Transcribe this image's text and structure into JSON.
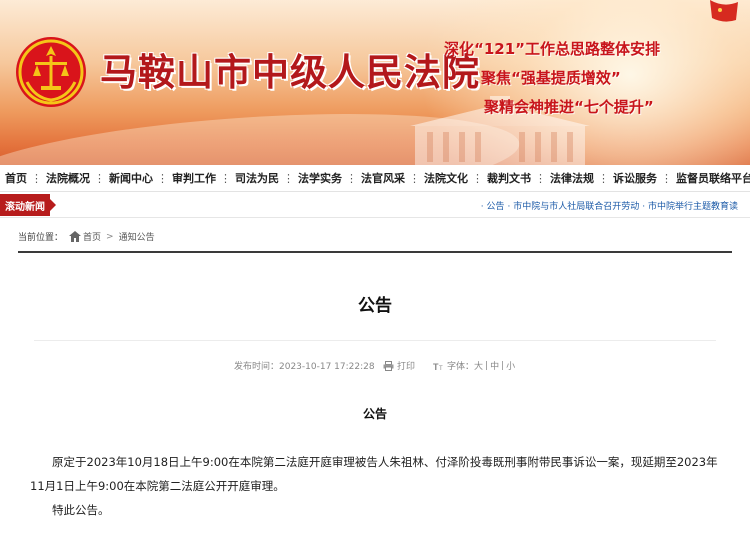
{
  "header": {
    "court_name": "马鞍山市中级人民法院",
    "slogans": [
      "深化“121”工作总思路整体安排",
      "聚焦“强基提质增效”",
      "聚精会神推进“七个提升”"
    ]
  },
  "nav": {
    "items": [
      "首页",
      "法院概况",
      "新闻中心",
      "审判工作",
      "司法为民",
      "法学实务",
      "法官风采",
      "法院文化",
      "裁判文书",
      "法律法规",
      "诉讼服务",
      "监督员联络平台"
    ]
  },
  "scroll_news": {
    "label": "滚动新闻",
    "items": [
      "· 公告",
      "· 市中院与市人社局联合召开劳动",
      "· 市中院举行主题教育读"
    ]
  },
  "breadcrumb": {
    "label": "当前位置：",
    "home": "首页",
    "arrow": ">",
    "current": "通知公告"
  },
  "article": {
    "title": "公告",
    "publish_label": "发布时间：2023-10-17 17:22:28",
    "print_label": "打印",
    "font_label": "字体：",
    "font_large": "大",
    "font_mid": "中",
    "font_small": "小",
    "font_sep": "|",
    "heading": "公告",
    "paragraph1": "原定于2023年10月18日上午9:00在本院第二法庭开庭审理被告人朱祖林、付泽阶投毒既刑事附带民事诉讼一案，现延期至2023年11月1日上午9:00在本院第二法庭公开开庭审理。",
    "paragraph2": "特此公告。"
  },
  "colors": {
    "brand_red": "#b3181b",
    "tag_red": "#b71c1c",
    "link_blue": "#1d5ba8"
  }
}
